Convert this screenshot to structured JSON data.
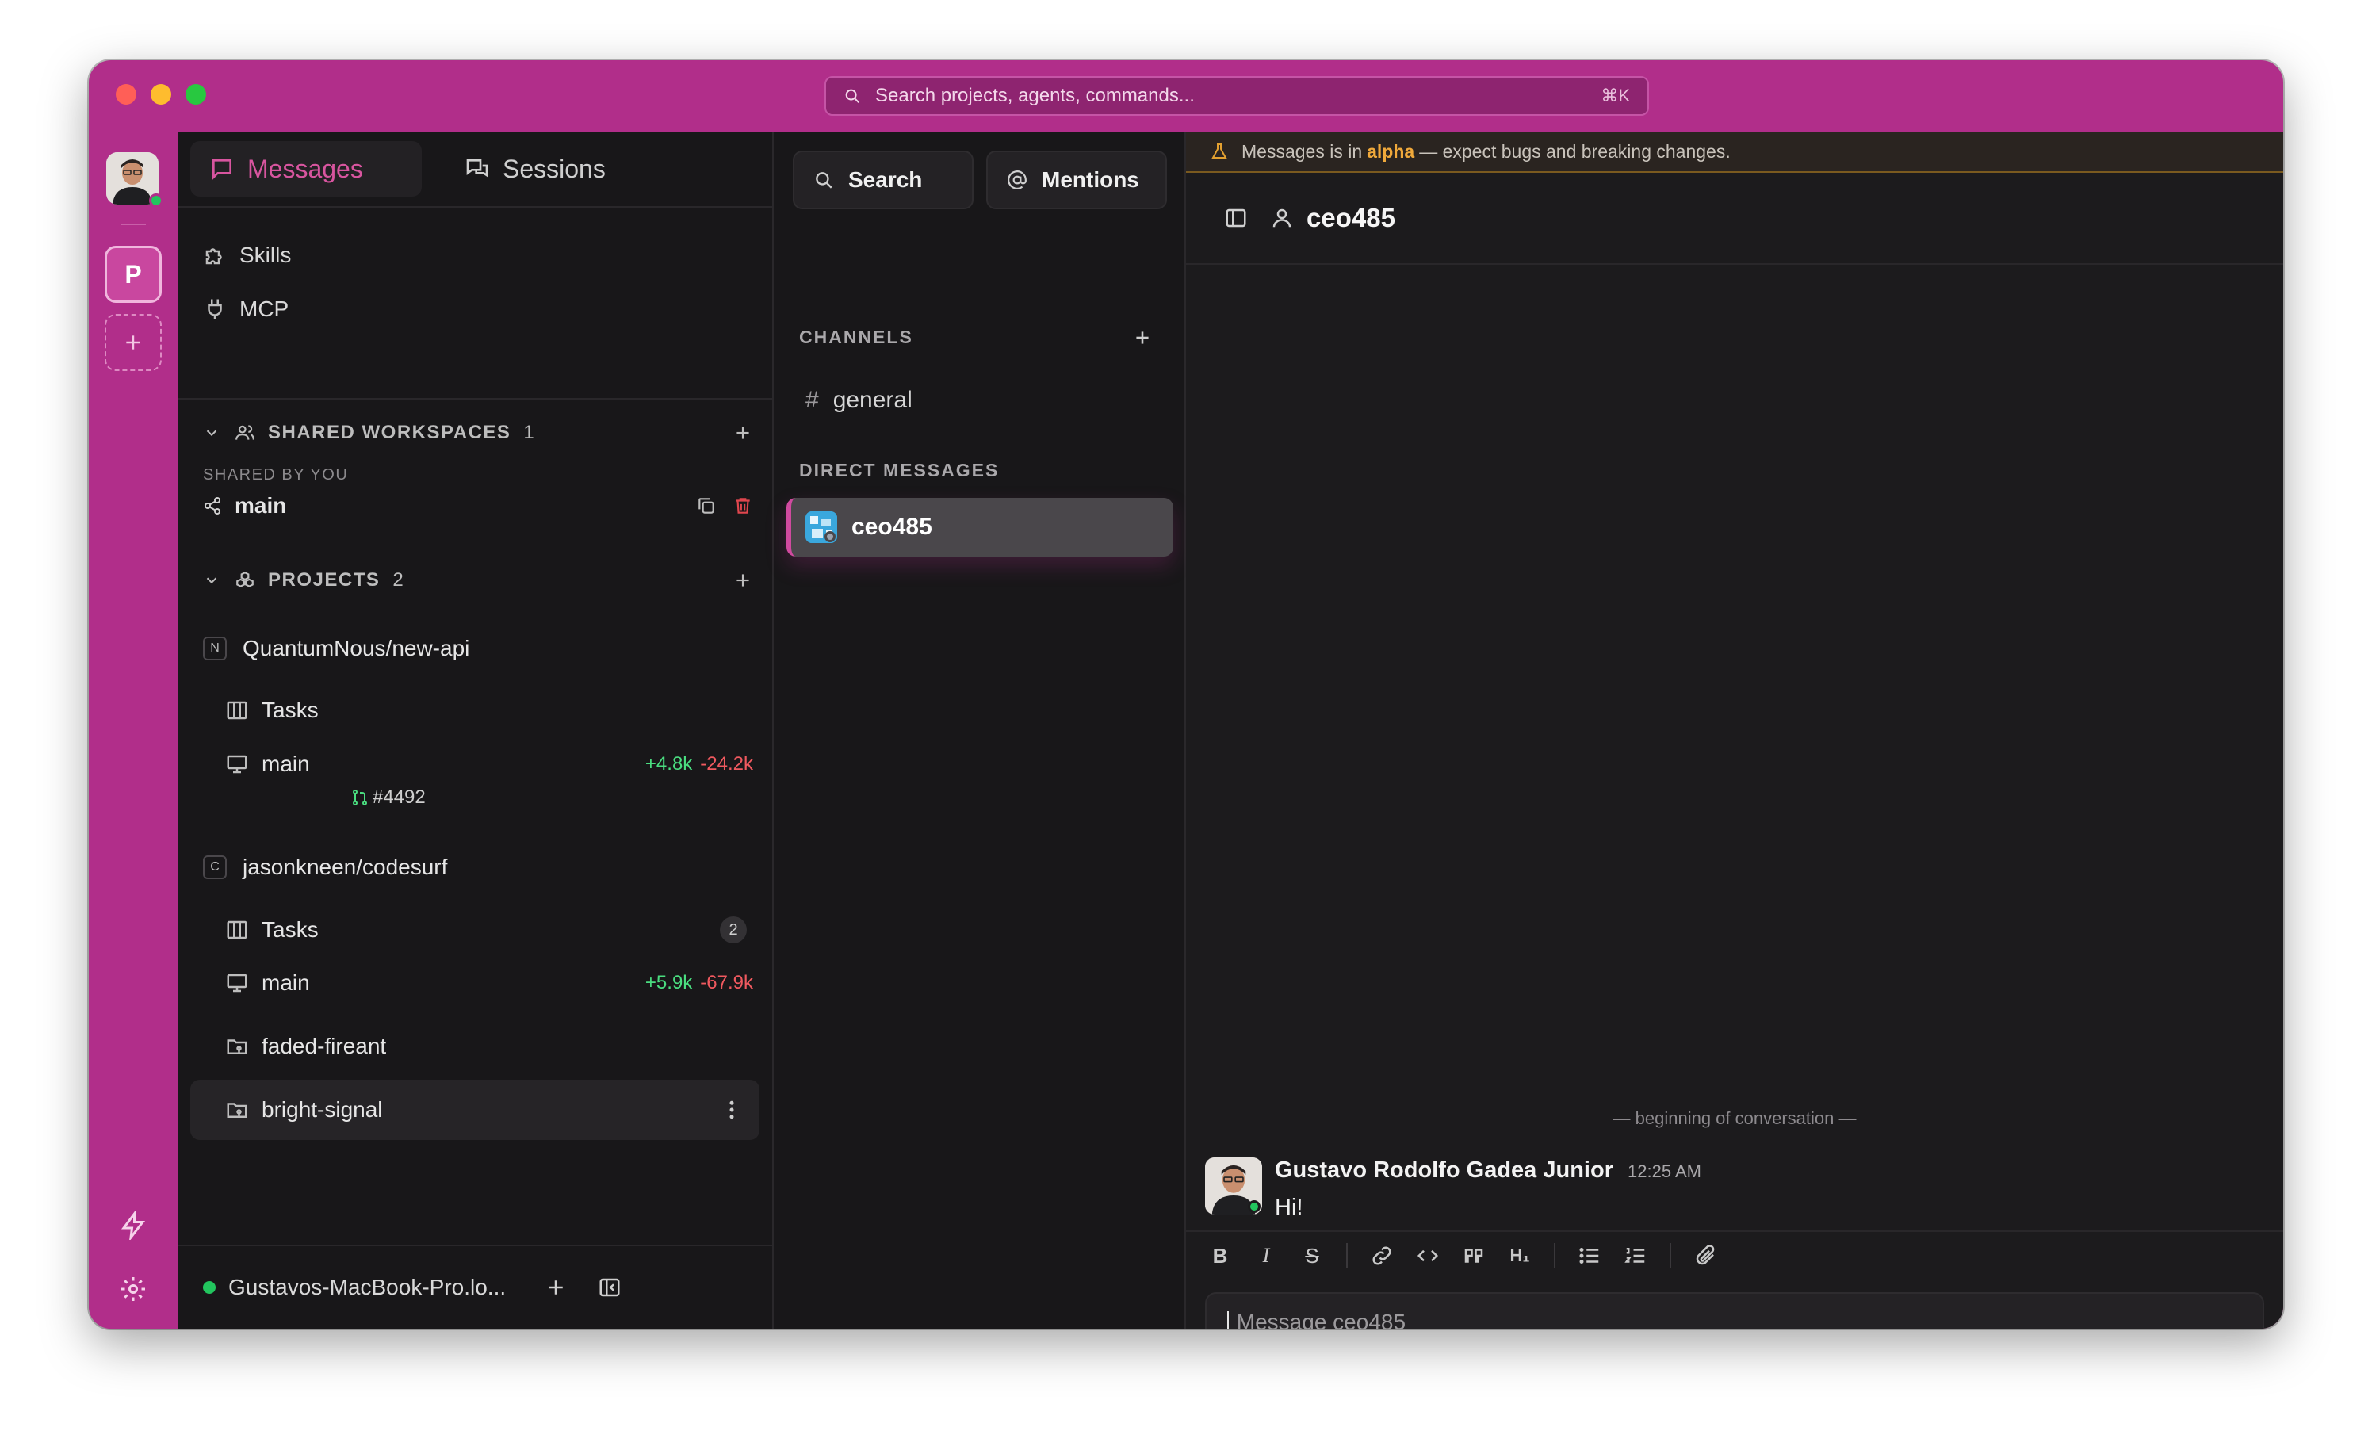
{
  "window": {
    "search": {
      "placeholder": "Search projects, agents, commands...",
      "shortcut": "⌘K"
    }
  },
  "rail": {
    "workspace_letter": "P"
  },
  "sidebar": {
    "tabs": [
      {
        "label": "Messages",
        "active": true
      },
      {
        "label": "Sessions",
        "active": false
      }
    ],
    "nav": [
      {
        "label": "Skills",
        "icon": "puzzle-icon"
      },
      {
        "label": "MCP",
        "icon": "plug-icon"
      }
    ],
    "shared_workspaces": {
      "title": "SHARED WORKSPACES",
      "count": "1",
      "subtitle": "SHARED BY YOU",
      "items": [
        {
          "label": "main"
        }
      ]
    },
    "projects": {
      "title": "PROJECTS",
      "count": "2",
      "items": [
        {
          "badge": "N",
          "name": "QuantumNous/new-api",
          "tasks_label": "Tasks",
          "branch": "main",
          "adds": "+4.8k",
          "dels": "-24.2k",
          "pr": "#4492"
        },
        {
          "badge": "C",
          "name": "jasonkneen/codesurf",
          "tasks_label": "Tasks",
          "tasks_count": "2",
          "branch": "main",
          "adds": "+5.9k",
          "dels": "-67.9k",
          "worktrees": [
            "faded-fireant",
            "bright-signal"
          ]
        }
      ]
    },
    "footer": {
      "host": "Gustavos-MacBook-Pro.lo...",
      "status_color": "#22c55e"
    }
  },
  "channels": {
    "search_label": "Search",
    "mentions_label": "Mentions",
    "channels_header": "CHANNELS",
    "channels": [
      {
        "name": "general"
      }
    ],
    "dm_header": "DIRECT MESSAGES",
    "dms": [
      {
        "name": "ceo485",
        "active": true
      }
    ]
  },
  "main": {
    "alpha_banner": {
      "prefix": "Messages is in",
      "highlight": "alpha",
      "suffix": "— expect bugs and breaking changes."
    },
    "conversation_title": "ceo485",
    "beginning": "— beginning of conversation —",
    "messages": [
      {
        "author": "Gustavo Rodolfo Gadea Junior",
        "time": "12:25 AM",
        "text": "Hi!"
      }
    ],
    "composer": {
      "placeholder": "Message ceo485"
    }
  },
  "colors": {
    "accent": "#b12e8a",
    "messages_tab": "#d8559f",
    "additions": "#4ade80",
    "deletions": "#f0595f",
    "alpha": "#f0a93b"
  }
}
